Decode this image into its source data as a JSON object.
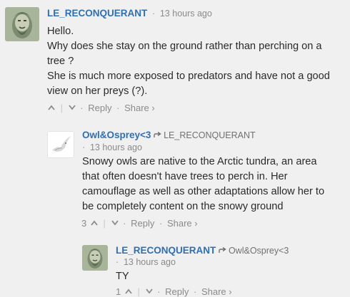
{
  "comments": [
    {
      "author": "LE_RECONQUERANT",
      "time": "13 hours ago",
      "lines": [
        "Hello.",
        "Why does she stay on the ground rather than perching on a",
        "tree ?",
        "She is much more exposed to predators and have not a good",
        "view on her preys (?)."
      ],
      "vote_up": "^",
      "vote_sep": "|",
      "vote_down": "v",
      "reply": "Reply",
      "share": "Share ›"
    },
    {
      "author": "Owl&Osprey<3",
      "reply_to": "LE_RECONQUERANT",
      "time": "13 hours ago",
      "lines": [
        "Snowy owls are native to the Arctic tundra, an area",
        "that often doesn't have trees to perch in. Her",
        "camouflage as well as other adaptations allow her to",
        "be completely content on the snowy ground"
      ],
      "upvotes": "3",
      "reply": "Reply",
      "share": "Share ›"
    },
    {
      "author": "LE_RECONQUERANT",
      "reply_to": "Owl&Osprey<3",
      "time": "13 hours ago",
      "lines": [
        "TY"
      ],
      "upvotes": "1",
      "reply": "Reply",
      "share": "Share ›"
    }
  ],
  "colors": {
    "author": "#2e6fb5",
    "background": "#f0f0f0",
    "muted": "#8a8a8a"
  }
}
